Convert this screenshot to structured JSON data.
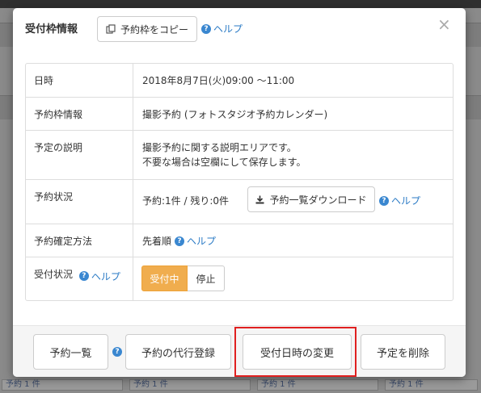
{
  "modal": {
    "title": "受付枠情報",
    "copy_button": "予約枠をコピー",
    "help_label": "ヘルプ",
    "close_symbol": "×"
  },
  "rows": {
    "datetime": {
      "label": "日時",
      "value": "2018年8月7日(火)09:00 ～11:00"
    },
    "slot_info": {
      "label": "予約枠情報",
      "value": "撮影予約 (フォトスタジオ予約カレンダー)"
    },
    "description": {
      "label": "予定の説明",
      "line1": "撮影予約に関する説明エリアです。",
      "line2": "不要な場合は空欄にして保存します。"
    },
    "status": {
      "label": "予約状況",
      "value": "予約:1件 / 残り:0件",
      "download_button": "予約一覧ダウンロード",
      "help": "ヘルプ"
    },
    "confirm_method": {
      "label": "予約確定方法",
      "value": "先着順",
      "help": "ヘルプ"
    },
    "accept_status": {
      "label": "受付状況",
      "help": "ヘルプ",
      "on_label": "受付中",
      "off_label": "停止"
    }
  },
  "footer": {
    "list_button": "予約一覧",
    "proxy_button": "予約の代行登録",
    "change_datetime_button": "受付日時の変更",
    "delete_button": "予定を削除"
  },
  "background": {
    "cell_text": "予約 1 件"
  },
  "colors": {
    "accent_orange": "#f0ad4e",
    "link_blue": "#2a7ac5",
    "highlight_red": "#e02020"
  },
  "icons": {
    "copy": "copy-icon",
    "help": "help-circle-icon",
    "download": "download-icon",
    "close": "close-icon"
  }
}
